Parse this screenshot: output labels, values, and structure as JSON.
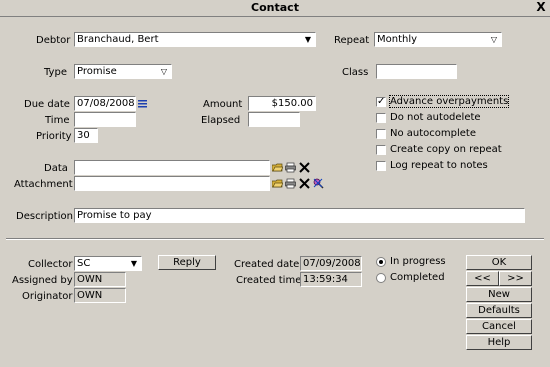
{
  "window": {
    "title": "Contact",
    "close": "X"
  },
  "form": {
    "debtor_label": "Debtor",
    "debtor_value": "Branchaud, Bert",
    "repeat_label": "Repeat",
    "repeat_value": "Monthly",
    "type_label": "Type",
    "type_value": "Promise",
    "class_label": "Class",
    "class_value": "",
    "due_date_label": "Due date",
    "due_date_value": "07/08/2008",
    "time_label": "Time",
    "time_value": "",
    "priority_label": "Priority",
    "priority_value": "30",
    "amount_label": "Amount",
    "amount_value": "$150.00",
    "elapsed_label": "Elapsed",
    "elapsed_value": "",
    "data_label": "Data",
    "data_value": "",
    "attachment_label": "Attachment",
    "attachment_value": "",
    "description_label": "Description",
    "description_value": "Promise to pay"
  },
  "options": [
    {
      "label": "Advance overpayments",
      "checked": true
    },
    {
      "label": "Do not autodelete",
      "checked": false
    },
    {
      "label": "No autocomplete",
      "checked": false
    },
    {
      "label": "Create copy on repeat",
      "checked": false
    },
    {
      "label": "Log repeat to notes",
      "checked": false
    }
  ],
  "bottom": {
    "collector_label": "Collector",
    "collector_value": "SC",
    "assigned_label": "Assigned by",
    "assigned_value": "OWN",
    "originator_label": "Originator",
    "originator_value": "OWN",
    "reply_label": "Reply",
    "created_date_label": "Created date",
    "created_date_value": "07/09/2008",
    "created_time_label": "Created time",
    "created_time_value": "13:59:34",
    "status_in_progress": "In progress",
    "status_completed": "Completed"
  },
  "buttons": {
    "ok": "OK",
    "prev": "<<",
    "next": ">>",
    "new": "New",
    "defaults": "Defaults",
    "cancel": "Cancel",
    "help": "Help"
  }
}
